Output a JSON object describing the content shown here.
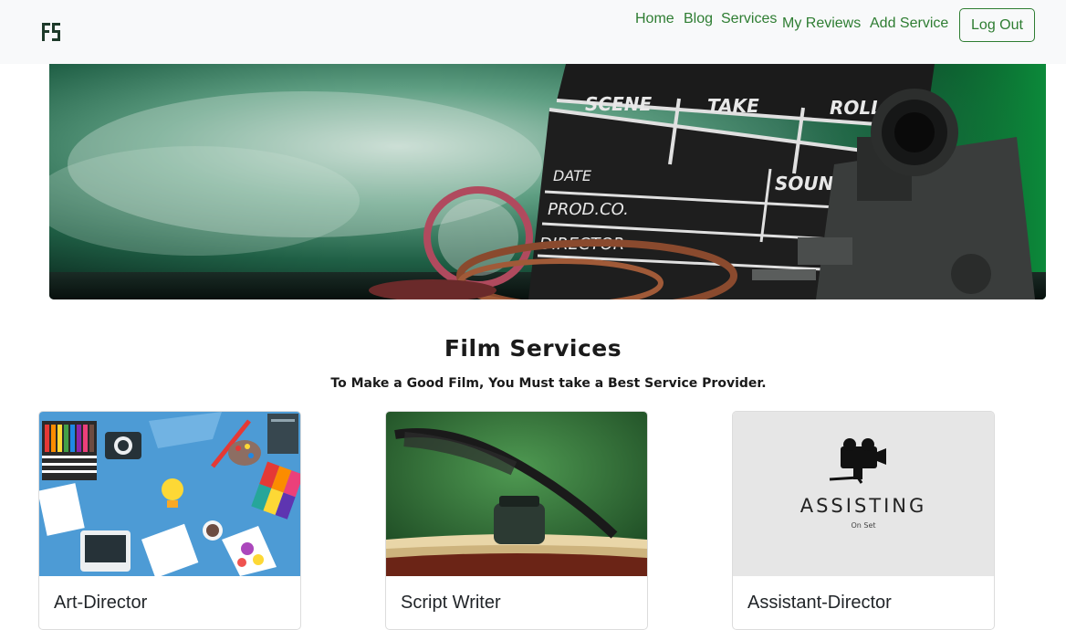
{
  "nav": {
    "logo_alt": "FS",
    "links": [
      "Home",
      "Blog",
      "Services",
      "My Reviews",
      "Add Service"
    ],
    "logout_label": "Log Out"
  },
  "banner": {
    "clapper_labels": [
      "SCENE",
      "TAKE",
      "ROLL",
      "DATE",
      "SOUND",
      "PROD.CO.",
      "DIRECTOR"
    ]
  },
  "section": {
    "title": "Film Services",
    "subtitle": "To Make a Good Film, You Must take a Best Service Provider."
  },
  "cards": [
    {
      "title": "Art-Director"
    },
    {
      "title": "Script Writer"
    },
    {
      "title": "Assistant-Director",
      "image_text": "ASSISTING",
      "image_subtext": "On Set"
    }
  ],
  "colors": {
    "accent": "#2e7d32",
    "navbar_bg": "#f8f9fa"
  }
}
